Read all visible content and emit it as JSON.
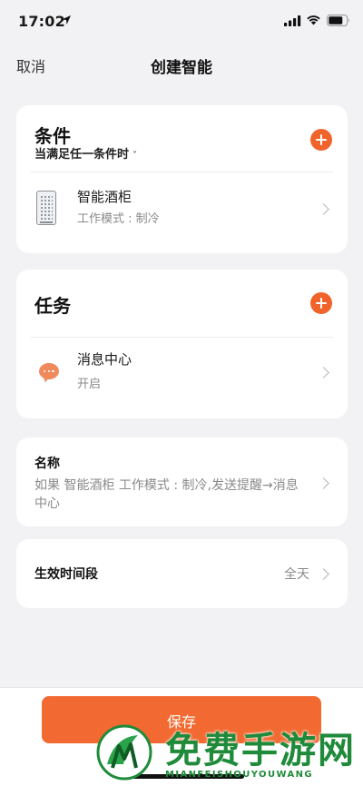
{
  "status_bar": {
    "time": "17:02",
    "icons": [
      "location-arrow-icon",
      "signal-icon",
      "wifi-icon",
      "battery-icon"
    ]
  },
  "nav": {
    "cancel_label": "取消",
    "title": "创建智能"
  },
  "conditions": {
    "title": "条件",
    "mode": "当满足任一条件时",
    "mode_caret": "˅",
    "items": [
      {
        "icon": "wine-cabinet-icon",
        "name": "智能酒柜",
        "detail": "工作模式 : 制冷"
      }
    ]
  },
  "tasks": {
    "title": "任务",
    "items": [
      {
        "icon": "message-bubble-icon",
        "name": "消息中心",
        "detail": "开启"
      }
    ]
  },
  "name_section": {
    "label": "名称",
    "description": "如果 智能酒柜 工作模式 : 制冷,发送提醒→消息中心"
  },
  "time_section": {
    "label": "生效时间段",
    "value": "全天"
  },
  "footer": {
    "save_label": "保存"
  },
  "watermark": {
    "text": "免费手游网",
    "subtext": "MIANFEISHOUYOUWANG"
  },
  "colors": {
    "accent": "#f0642b",
    "save_button": "#f26a31",
    "background": "#f2f2f4",
    "watermark": "#1f8b3a"
  }
}
